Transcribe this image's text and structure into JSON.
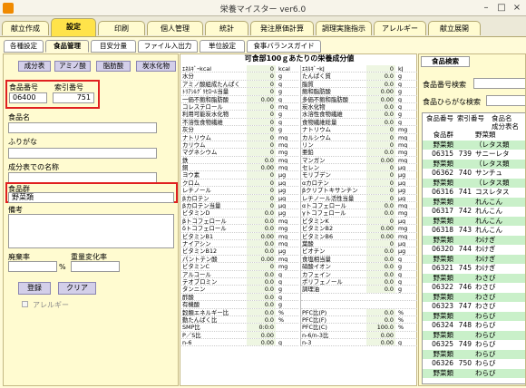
{
  "window": {
    "title": "栄養マイスター ver6.0",
    "min": "–",
    "max": "□",
    "close": "×"
  },
  "main_tabs": [
    "献立作成",
    "設定",
    "印刷",
    "個人管理",
    "統計",
    "発注原価計算",
    "調理実施指示",
    "アレルギー",
    "献立展開"
  ],
  "active_main_tab": "設定",
  "sub_tabs": [
    "各種設定",
    "食品管理",
    "目安分量",
    "ファイル入出力",
    "単位設定",
    "食事バランスガイド"
  ],
  "active_sub_tab": "食品管理",
  "left": {
    "category_buttons": [
      "成分表",
      "アミノ酸",
      "脂肪酸",
      "炭水化物"
    ],
    "food_no_label": "食品番号",
    "food_no": "06400",
    "index_no_label": "索引番号",
    "index_no": "751",
    "food_name_label": "食品名",
    "food_name": "",
    "furigana_label": "ふりがな",
    "furigana": "",
    "table_name_label": "成分表での名称",
    "table_name": "",
    "group_label": "食品群",
    "group_value": "野菜類",
    "remarks_label": "備考",
    "remarks": "",
    "waste_label": "廃棄率",
    "waste_value": "",
    "waste_unit": "%",
    "weight_change_label": "重量変化率",
    "weight_change_value": "",
    "register_button": "登録",
    "clear_button": "クリア",
    "allergy_label": "アレルギー"
  },
  "mid": {
    "title": "可食部100ｇあたりの栄養成分値",
    "left_col": [
      {
        "name": "ｴﾈﾙｷﾞｰkcal",
        "value": "0",
        "unit": "kcal"
      },
      {
        "name": "水分",
        "value": "0",
        "unit": "g"
      },
      {
        "name": "アミノ酸組成たんぱく",
        "value": "0",
        "unit": "g"
      },
      {
        "name": "ﾄﾘｱｼﾙｸﾞﾘｾﾛｰﾙ当量",
        "value": "0",
        "unit": "g"
      },
      {
        "name": "一価不飽和脂肪酸",
        "value": "0.00",
        "unit": "g"
      },
      {
        "name": "コレステロール",
        "value": "0",
        "unit": "mg"
      },
      {
        "name": "利用可能炭水化物",
        "value": "0",
        "unit": "g"
      },
      {
        "name": "不溶性食物繊維",
        "value": "0",
        "unit": "g"
      },
      {
        "name": "灰分",
        "value": "0",
        "unit": "g"
      },
      {
        "name": "ナトリウム",
        "value": "0",
        "unit": "mg"
      },
      {
        "name": "カリウム",
        "value": "0",
        "unit": "mg"
      },
      {
        "name": "マグネシウム",
        "value": "0",
        "unit": "mg"
      },
      {
        "name": "鉄",
        "value": "0.0",
        "unit": "mg"
      },
      {
        "name": "銅",
        "value": "0.00",
        "unit": "mg"
      },
      {
        "name": "ヨウ素",
        "value": "0",
        "unit": "μg"
      },
      {
        "name": "クロム",
        "value": "0",
        "unit": "μg"
      },
      {
        "name": "レチノール",
        "value": "0",
        "unit": "μg"
      },
      {
        "name": "βカロテン",
        "value": "0",
        "unit": "μg"
      },
      {
        "name": "βカロテン当量",
        "value": "0",
        "unit": "μg"
      },
      {
        "name": "ビタミンD",
        "value": "0.0",
        "unit": "μg"
      },
      {
        "name": "βトコフェロール",
        "value": "0.0",
        "unit": "mg"
      },
      {
        "name": "δトコフェロール",
        "value": "0.0",
        "unit": "mg"
      },
      {
        "name": "ビタミンB1",
        "value": "0.00",
        "unit": "mg"
      },
      {
        "name": "ナイアシン",
        "value": "0.0",
        "unit": "mg"
      },
      {
        "name": "ビタミンB12",
        "value": "0.0",
        "unit": "μg"
      },
      {
        "name": "パントテン酸",
        "value": "0.00",
        "unit": "mg"
      },
      {
        "name": "ビタミンC",
        "value": "0",
        "unit": "mg"
      },
      {
        "name": "アルコール",
        "value": "0.0",
        "unit": "g"
      },
      {
        "name": "テオブロミン",
        "value": "0.0",
        "unit": "g"
      },
      {
        "name": "タンニン",
        "value": "0.0",
        "unit": "g"
      },
      {
        "name": "酢酸",
        "value": "0.0",
        "unit": "g"
      },
      {
        "name": "有機酸",
        "value": "0.0",
        "unit": "g"
      },
      {
        "name": "穀類エネルギー比",
        "value": "0.0",
        "unit": "%"
      },
      {
        "name": "動たんぱく比",
        "value": "0.0",
        "unit": "%"
      },
      {
        "name": "SMP比",
        "value": "0:0:0",
        "unit": ""
      },
      {
        "name": "P／S比",
        "value": "0.00",
        "unit": ""
      },
      {
        "name": "n-6",
        "value": "0.00",
        "unit": "g"
      }
    ],
    "right_col": [
      {
        "name": "ｴﾈﾙｷﾞｰkJ",
        "value": "0",
        "unit": "kJ"
      },
      {
        "name": "たんぱく質",
        "value": "0.0",
        "unit": "g"
      },
      {
        "name": "脂質",
        "value": "0.0",
        "unit": "g"
      },
      {
        "name": "飽和脂肪酸",
        "value": "0.00",
        "unit": "g"
      },
      {
        "name": "多価不飽和脂肪酸",
        "value": "0.00",
        "unit": "g"
      },
      {
        "name": "炭水化物",
        "value": "0.0",
        "unit": "g"
      },
      {
        "name": "水溶性食物繊維",
        "value": "0.0",
        "unit": "g"
      },
      {
        "name": "食物繊維総量",
        "value": "0.0",
        "unit": "g"
      },
      {
        "name": "ナトリウム",
        "value": "0",
        "unit": "mg"
      },
      {
        "name": "カルシウム",
        "value": "0",
        "unit": "mg"
      },
      {
        "name": "リン",
        "value": "0",
        "unit": "mg"
      },
      {
        "name": "亜鉛",
        "value": "0.0",
        "unit": "mg"
      },
      {
        "name": "マンガン",
        "value": "0.00",
        "unit": "mg"
      },
      {
        "name": "セレン",
        "value": "0",
        "unit": "μg"
      },
      {
        "name": "モリブデン",
        "value": "0",
        "unit": "μg"
      },
      {
        "name": "αカロテン",
        "value": "0",
        "unit": "μg"
      },
      {
        "name": "βクリプトキサンチン",
        "value": "0",
        "unit": "μg"
      },
      {
        "name": "レチノール活性当量",
        "value": "0",
        "unit": "μg"
      },
      {
        "name": "αトコフェロール",
        "value": "0.0",
        "unit": "mg"
      },
      {
        "name": "γトコフェロール",
        "value": "0.0",
        "unit": "mg"
      },
      {
        "name": "ビタミンK",
        "value": "0",
        "unit": "μg"
      },
      {
        "name": "ビタミンB2",
        "value": "0.00",
        "unit": "mg"
      },
      {
        "name": "ビタミンB6",
        "value": "0.00",
        "unit": "mg"
      },
      {
        "name": "葉酸",
        "value": "0",
        "unit": "μg"
      },
      {
        "name": "ビオチン",
        "value": "0.0",
        "unit": "μg"
      },
      {
        "name": "食塩相当量",
        "value": "0.0",
        "unit": "g"
      },
      {
        "name": "硝酸イオン",
        "value": "0.0",
        "unit": "g"
      },
      {
        "name": "カフェイン",
        "value": "0.0",
        "unit": "g"
      },
      {
        "name": "ポリフェノール",
        "value": "0.0",
        "unit": "g"
      },
      {
        "name": "調理油",
        "value": "0.0",
        "unit": "g"
      },
      {
        "name": "",
        "value": "",
        "unit": ""
      },
      {
        "name": "",
        "value": "",
        "unit": ""
      },
      {
        "name": "PFC比(P)",
        "value": "0.0",
        "unit": "%"
      },
      {
        "name": "PFC比(F)",
        "value": "0.0",
        "unit": "%"
      },
      {
        "name": "PFC比(C)",
        "value": "100.0",
        "unit": "%"
      },
      {
        "name": "n-6/n-3比",
        "value": "0.00",
        "unit": ""
      },
      {
        "name": "n-3",
        "value": "0.00",
        "unit": "g"
      }
    ]
  },
  "right": {
    "tab": "食品検索",
    "food_no_search_label": "食品番号検索",
    "hiragana_search_label": "食品ひらがな検索",
    "header": {
      "col1": "食品番号",
      "col2": "索引番号",
      "col3": "食品名",
      "col3b": "成分表名"
    },
    "rows": [
      {
        "c1": "食品群",
        "c2": "",
        "c3": "野菜類",
        "g": false
      },
      {
        "c1": "野菜類",
        "c2": "",
        "c3": "（レタス類",
        "g": true
      },
      {
        "c1": "06315",
        "c2": "739",
        "c3": "サニーレタ",
        "g": false
      },
      {
        "c1": "野菜類",
        "c2": "",
        "c3": "（レタス類",
        "g": true
      },
      {
        "c1": "06362",
        "c2": "740",
        "c3": "サンチュ",
        "g": false
      },
      {
        "c1": "野菜類",
        "c2": "",
        "c3": "（レタス類",
        "g": true
      },
      {
        "c1": "06316",
        "c2": "741",
        "c3": "コスレタス",
        "g": false
      },
      {
        "c1": "野菜類",
        "c2": "",
        "c3": "れんこん",
        "g": true
      },
      {
        "c1": "06317",
        "c2": "742",
        "c3": "れんこん",
        "g": false
      },
      {
        "c1": "野菜類",
        "c2": "",
        "c3": "れんこん",
        "g": true
      },
      {
        "c1": "06318",
        "c2": "743",
        "c3": "れんこん",
        "g": false
      },
      {
        "c1": "野菜類",
        "c2": "",
        "c3": "わけぎ",
        "g": true
      },
      {
        "c1": "06320",
        "c2": "744",
        "c3": "わけぎ",
        "g": false
      },
      {
        "c1": "野菜類",
        "c2": "",
        "c3": "わけぎ",
        "g": true
      },
      {
        "c1": "06321",
        "c2": "745",
        "c3": "わけぎ",
        "g": false
      },
      {
        "c1": "野菜類",
        "c2": "",
        "c3": "わさび",
        "g": true
      },
      {
        "c1": "06322",
        "c2": "746",
        "c3": "わさび",
        "g": false
      },
      {
        "c1": "野菜類",
        "c2": "",
        "c3": "わさび",
        "g": true
      },
      {
        "c1": "06323",
        "c2": "747",
        "c3": "わさび",
        "g": false
      },
      {
        "c1": "野菜類",
        "c2": "",
        "c3": "わらび",
        "g": true
      },
      {
        "c1": "06324",
        "c2": "748",
        "c3": "わらび",
        "g": false
      },
      {
        "c1": "野菜類",
        "c2": "",
        "c3": "わらび",
        "g": true
      },
      {
        "c1": "06325",
        "c2": "749",
        "c3": "わらび",
        "g": false
      },
      {
        "c1": "野菜類",
        "c2": "",
        "c3": "わらび",
        "g": true
      },
      {
        "c1": "06326",
        "c2": "750",
        "c3": "わらび",
        "g": false
      },
      {
        "c1": "野菜類",
        "c2": "",
        "c3": "わらび",
        "g": true
      }
    ]
  }
}
